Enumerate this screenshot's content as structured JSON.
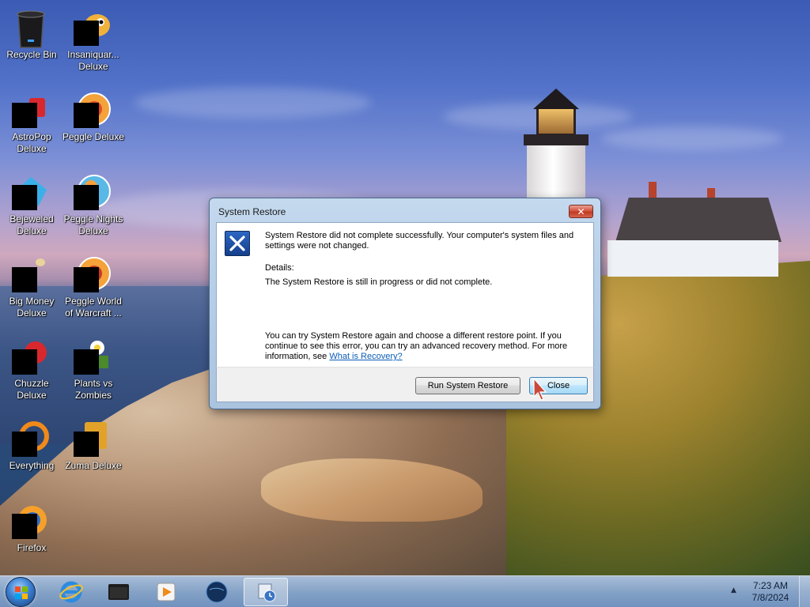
{
  "desktop": {
    "icons": [
      {
        "label": "Recycle Bin",
        "icon": "recycle-bin-icon"
      },
      {
        "label": "Insaniquar...\nDeluxe",
        "icon": "insaniquarium-icon"
      },
      {
        "label": "AstroPop\nDeluxe",
        "icon": "astropop-icon"
      },
      {
        "label": "Peggle Deluxe",
        "icon": "peggle-icon"
      },
      {
        "label": "Bejeweled\nDeluxe",
        "icon": "bejeweled-icon"
      },
      {
        "label": "Peggle Nights\nDeluxe",
        "icon": "peggle-nights-icon"
      },
      {
        "label": "Big Money\nDeluxe",
        "icon": "big-money-icon"
      },
      {
        "label": "Peggle World\nof Warcraft ...",
        "icon": "peggle-wow-icon"
      },
      {
        "label": "Chuzzle\nDeluxe",
        "icon": "chuzzle-icon"
      },
      {
        "label": "Plants vs\nZombies",
        "icon": "plants-vs-zombies-icon"
      },
      {
        "label": "Everything",
        "icon": "everything-icon"
      },
      {
        "label": "Zuma Deluxe",
        "icon": "zuma-icon"
      },
      {
        "label": "Firefox",
        "icon": "firefox-icon"
      }
    ]
  },
  "dialog": {
    "title": "System Restore",
    "close_glyph": "✕",
    "message": "System Restore did not complete successfully. Your computer's system files and settings were not changed.",
    "details_label": "Details:",
    "details_text": "The System Restore is still in progress or did not complete.",
    "advice_text": "You can try System Restore again and choose a different restore point.  If you continue to see this error, you can try an advanced recovery method. For more information, see",
    "link_text": "What is Recovery?",
    "buttons": {
      "run": "Run System Restore",
      "close": "Close"
    }
  },
  "taskbar": {
    "items": [
      "start-orb",
      "internet-explorer-icon",
      "file-explorer-icon",
      "media-player-icon",
      "globe-icon",
      "system-restore-icon"
    ],
    "clock_time": "7:23 AM",
    "clock_date": "7/8/2024",
    "tray_arrow": "▲"
  }
}
